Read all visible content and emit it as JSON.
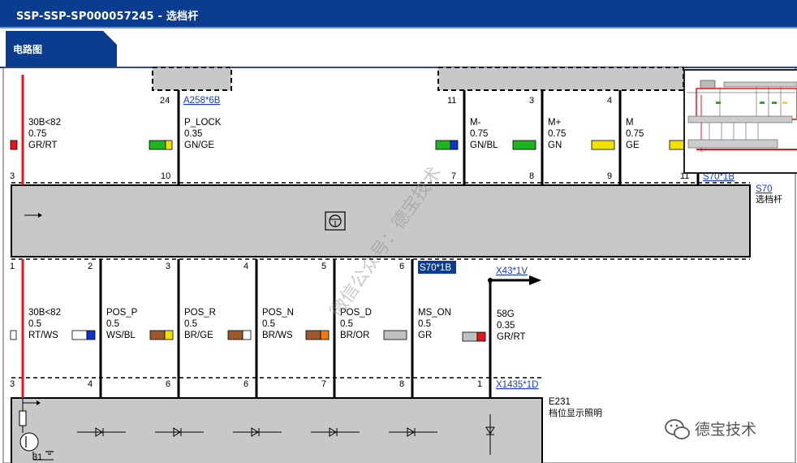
{
  "window": {
    "title": "SSP-SSP-SP000057245 - 选档杆"
  },
  "tab": {
    "label": "电路图"
  },
  "watermark": "微信公众号：德宝技术",
  "logo": {
    "text": "德宝技术",
    "icon": "wechat-icon"
  },
  "connectors": {
    "a258": "A258*6B",
    "s70_top": "S70*1B",
    "s70_name": "S70",
    "s70_desc": "选档杆",
    "s70_bottom": "S70*1B",
    "x43": "X43*1V",
    "x1435": "X1435*1D",
    "e231_name": "E231",
    "e231_desc": "档位显示照明",
    "ground": "31"
  },
  "top_pins": {
    "a24": "24",
    "a10": "10",
    "p3": "3",
    "t11": "11",
    "t3": "3",
    "t4": "4",
    "b7": "7",
    "b8": "8",
    "b9": "9",
    "b11": "11"
  },
  "top_wires": [
    {
      "signal": "30B<82",
      "gauge": "0.75",
      "color": "GR/RT"
    },
    {
      "signal": "P_LOCK",
      "gauge": "0.35",
      "color": "GN/GE"
    },
    {
      "signal": "M-",
      "gauge": "0.75",
      "color": "GN/BL"
    },
    {
      "signal": "M+",
      "gauge": "0.75",
      "color": "GN"
    },
    {
      "signal": "M",
      "gauge": "0.75",
      "color": "GE"
    }
  ],
  "bottom_pins_top": {
    "p1": "1",
    "p2": "2",
    "p3": "3",
    "p4": "4",
    "p5": "5",
    "p6": "6"
  },
  "bottom_pins_bottom": {
    "q3": "3",
    "q4": "4",
    "q6a": "6",
    "q6b": "6",
    "q7": "7",
    "q8": "8",
    "q1": "1"
  },
  "bottom_wires": [
    {
      "signal": "30B<82",
      "gauge": "0.5",
      "color": "RT/WS"
    },
    {
      "signal": "POS_P",
      "gauge": "0.5",
      "color": "WS/BL"
    },
    {
      "signal": "POS_R",
      "gauge": "0.5",
      "color": "BR/GE"
    },
    {
      "signal": "POS_N",
      "gauge": "0.5",
      "color": "BR/WS"
    },
    {
      "signal": "POS_D",
      "gauge": "0.5",
      "color": "BR/OR"
    },
    {
      "signal": "MS_ON",
      "gauge": "0.5",
      "color": "GR"
    },
    {
      "signal": "58G",
      "gauge": "0.35",
      "color": "GR/RT"
    }
  ],
  "colors": {
    "brand": "#0a3d8f",
    "wire_red": "#e8141b",
    "module": "#c8c8c8",
    "link": "#1a3cc8"
  }
}
